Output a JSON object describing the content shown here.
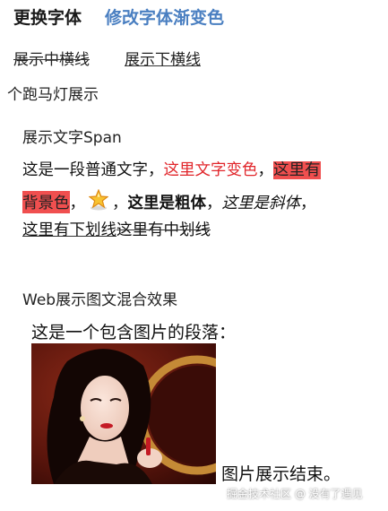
{
  "buttons": {
    "change_font": "更换字体",
    "change_font_gradient": "修改字体渐变色"
  },
  "decoration_buttons": {
    "strike": "展示中横线",
    "underline": "展示下横线"
  },
  "marquee": "个跑马灯展示",
  "span_section": {
    "title": "展示文字Span",
    "normal_text": "这是一段普通文字，",
    "colored_text": "这里文字变色",
    "comma1": "，",
    "bg_text_part1": "这里有",
    "bg_text_part2": "背景色",
    "comma2": "，",
    "star_icon": "star-icon",
    "comma3": "，",
    "bold_text": "这里是粗体",
    "comma4": "，",
    "italic_text": "这里是斜体",
    "comma5": "，",
    "underline_text": "这里有下划线",
    "strike_text": "这里有中划线",
    "colors": {
      "red": "#e1262b",
      "highlight_bg": "#f04f4f"
    }
  },
  "web_section": {
    "title": "Web展示图文混合效果",
    "paragraph_start": "这是一个包含图片的段落：",
    "paragraph_end": "图片展示结束。",
    "photo_icon": "portrait-photo"
  },
  "watermark": "掘金技术社区 @ 没有了遇见"
}
